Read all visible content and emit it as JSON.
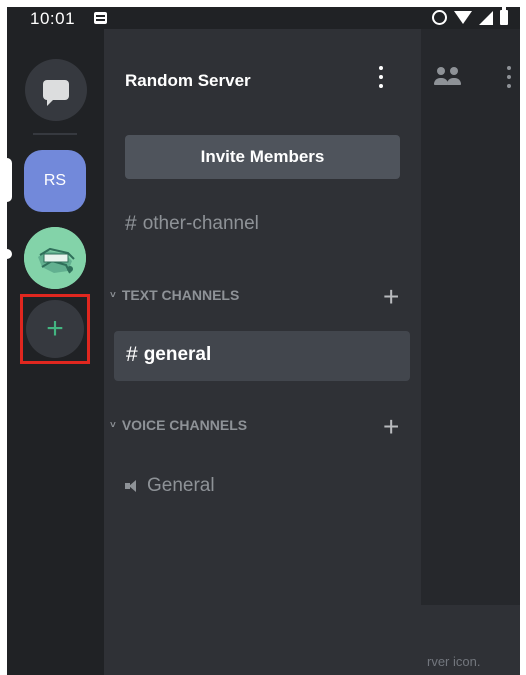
{
  "status_bar": {
    "time": "10:01"
  },
  "server_rail": {
    "selected_server_abbrev": "RS"
  },
  "channel_drawer": {
    "server_name": "Random Server",
    "invite_label": "Invite Members",
    "hash_symbol": "#",
    "channels": {
      "other": "other-channel",
      "general": "general",
      "voice_general": "General"
    },
    "categories": {
      "text": "TEXT CHANNELS",
      "voice": "VOICE CHANNELS"
    },
    "add_symbol": "+",
    "chevron_symbol": "˅"
  },
  "chat_area": {
    "partial_tooltip_text": "rver icon."
  },
  "colors": {
    "rail_bg": "#202225",
    "drawer_bg": "#2f3136",
    "blurple": "#7289da",
    "green": "#43b581",
    "highlight_red": "#e0271f",
    "active_channel_bg": "#42464d"
  },
  "icons": {
    "dm": "chat-bubble-icon",
    "add_server": "plus-icon",
    "server_menu": "vertical-dots-icon",
    "members": "members-icon",
    "voice": "speaker-icon"
  }
}
